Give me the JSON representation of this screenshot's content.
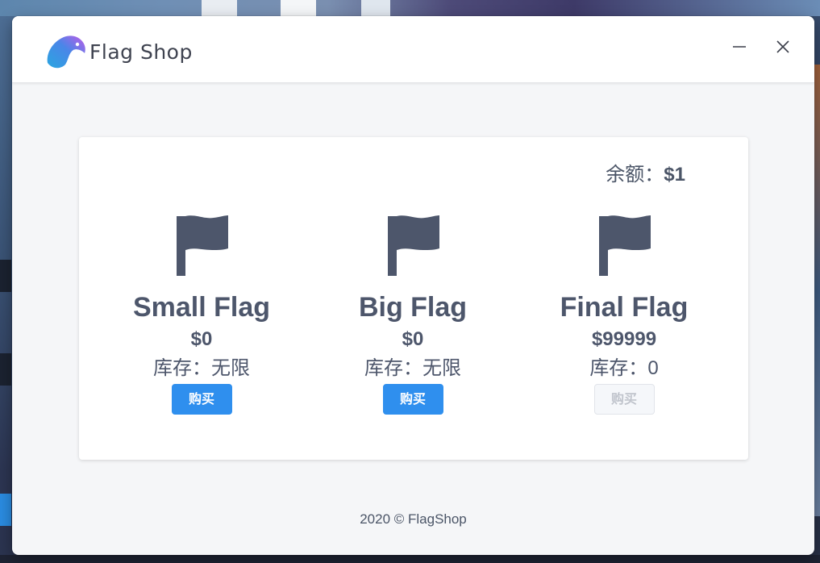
{
  "window": {
    "app_name": "Flag Shop"
  },
  "balance": {
    "label": "余额：",
    "value": "$1"
  },
  "products": [
    {
      "name": "Small Flag",
      "price": "$0",
      "stock_label": "库存：",
      "stock_value": "无限",
      "button_label": "购买",
      "button_enabled": true
    },
    {
      "name": "Big Flag",
      "price": "$0",
      "stock_label": "库存：",
      "stock_value": "无限",
      "button_label": "购买",
      "button_enabled": true
    },
    {
      "name": "Final Flag",
      "price": "$99999",
      "stock_label": "库存：",
      "stock_value": "0",
      "button_label": "购买",
      "button_enabled": false
    }
  ],
  "footer": {
    "text": "2020 © FlagShop"
  },
  "icons": {
    "logo": "bird-logo-icon",
    "minimize": "minimize-icon",
    "close": "close-icon",
    "product": "flag-icon"
  },
  "colors": {
    "primary_button": "#2f8fee",
    "text": "#4d566b",
    "disabled_text": "#c0c4cc",
    "window_bg": "#f5f6f8",
    "flag_icon": "#4d566b"
  }
}
